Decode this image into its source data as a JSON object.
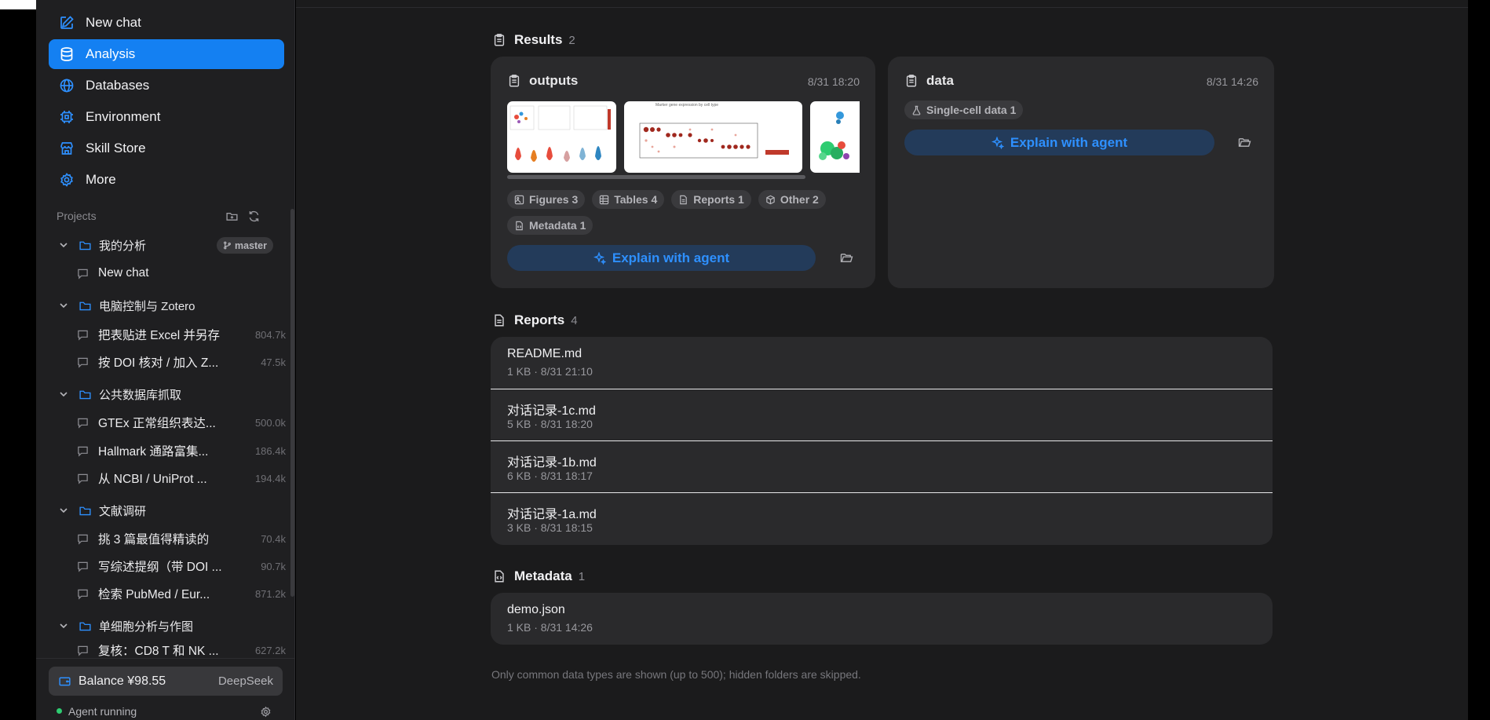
{
  "nav": [
    {
      "label": "New chat",
      "icon": "edit-icon"
    },
    {
      "label": "Analysis",
      "icon": "database-icon"
    },
    {
      "label": "Databases",
      "icon": "globe-icon"
    },
    {
      "label": "Environment",
      "icon": "chip-icon"
    },
    {
      "label": "Skill Store",
      "icon": "store-icon"
    },
    {
      "label": "More",
      "icon": "gear-icon"
    }
  ],
  "projects_label": "Projects",
  "projects": [
    {
      "name": "我的分析",
      "branch": "master",
      "chats": [
        {
          "title": "New chat",
          "tokens": ""
        }
      ]
    },
    {
      "name": "电脑控制与 Zotero",
      "chats": [
        {
          "title": "把表贴进 Excel 并另存",
          "tokens": "804.7k"
        },
        {
          "title": "按 DOI 核对 / 加入 Z...",
          "tokens": "47.5k"
        }
      ]
    },
    {
      "name": "公共数据库抓取",
      "chats": [
        {
          "title": "GTEx 正常组织表达...",
          "tokens": "500.0k"
        },
        {
          "title": "Hallmark 通路富集...",
          "tokens": "186.4k"
        },
        {
          "title": "从 NCBI / UniProt ...",
          "tokens": "194.4k"
        }
      ]
    },
    {
      "name": "文献调研",
      "chats": [
        {
          "title": "挑 3 篇最值得精读的",
          "tokens": "70.4k"
        },
        {
          "title": "写综述提纲（带 DOI ...",
          "tokens": "90.7k"
        },
        {
          "title": "检索 PubMed / Eur...",
          "tokens": "871.2k"
        }
      ]
    },
    {
      "name": "单细胞分析与作图",
      "chats": [
        {
          "title": "复核：CD8 T 和 NK ...",
          "tokens": "627.2k"
        }
      ]
    }
  ],
  "balance": {
    "label": "Balance ¥98.55",
    "provider": "DeepSeek"
  },
  "status": {
    "text": "Agent running",
    "color": "#2ecc71"
  },
  "results": {
    "title": "Results",
    "count": "2",
    "cards": [
      {
        "name": "outputs",
        "time": "8/31 18:20",
        "chips": [
          "Figures 3",
          "Tables 4",
          "Reports 1",
          "Other 2",
          "Metadata 1"
        ],
        "thumb_caption": "Marker gene expression by cell type",
        "explain": "Explain with agent"
      },
      {
        "name": "data",
        "time": "8/31 14:26",
        "chips": [
          "Single-cell data 1"
        ],
        "explain": "Explain with agent"
      }
    ]
  },
  "reports": {
    "title": "Reports",
    "count": "4",
    "items": [
      {
        "file": "README.md",
        "meta": "1 KB · 8/31 21:10"
      },
      {
        "file": "对话记录-1c.md",
        "meta": "5 KB · 8/31 18:20"
      },
      {
        "file": "对话记录-1b.md",
        "meta": "6 KB · 8/31 18:17"
      },
      {
        "file": "对话记录-1a.md",
        "meta": "3 KB · 8/31 18:15"
      }
    ]
  },
  "metadata": {
    "title": "Metadata",
    "count": "1",
    "items": [
      {
        "file": "demo.json",
        "meta": "1 KB · 8/31 14:26"
      }
    ]
  },
  "footnote": "Only common data types are shown (up to 500); hidden folders are skipped.",
  "accent": "#1480f2"
}
